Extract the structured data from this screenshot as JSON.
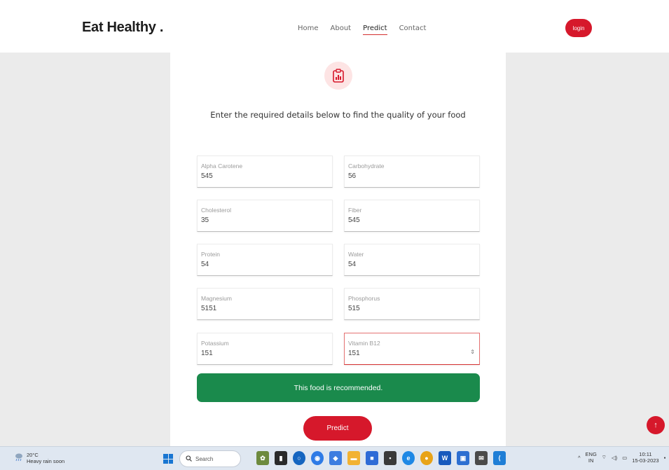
{
  "header": {
    "logo": "Eat Healthy .",
    "nav": [
      "Home",
      "About",
      "Predict",
      "Contact"
    ],
    "active_nav": "Predict",
    "login_label": "login"
  },
  "main": {
    "subtitle": "Enter the required details below to find the quality of your food",
    "fields": [
      {
        "label": "Alpha Carotene",
        "value": "545"
      },
      {
        "label": "Carbohydrate",
        "value": "56"
      },
      {
        "label": "Cholesterol",
        "value": "35"
      },
      {
        "label": "Fiber",
        "value": "545"
      },
      {
        "label": "Protein",
        "value": "54"
      },
      {
        "label": "Water",
        "value": "54"
      },
      {
        "label": "Magnesium",
        "value": "5151"
      },
      {
        "label": "Phosphorus",
        "value": "515"
      },
      {
        "label": "Potassium",
        "value": "151"
      },
      {
        "label": "Vitamin B12",
        "value": "151"
      }
    ],
    "result": "This food is recommended.",
    "predict_label": "Predict",
    "scroll_top_label": "↑"
  },
  "taskbar": {
    "weather_temp": "20°C",
    "weather_desc": "Heavy rain soon",
    "search_label": "Search",
    "lang_top": "ENG",
    "lang_bottom": "IN",
    "time": "10:11",
    "date": "15-03-2023"
  },
  "colors": {
    "accent": "#d6182b",
    "success": "#1a8a4c"
  }
}
